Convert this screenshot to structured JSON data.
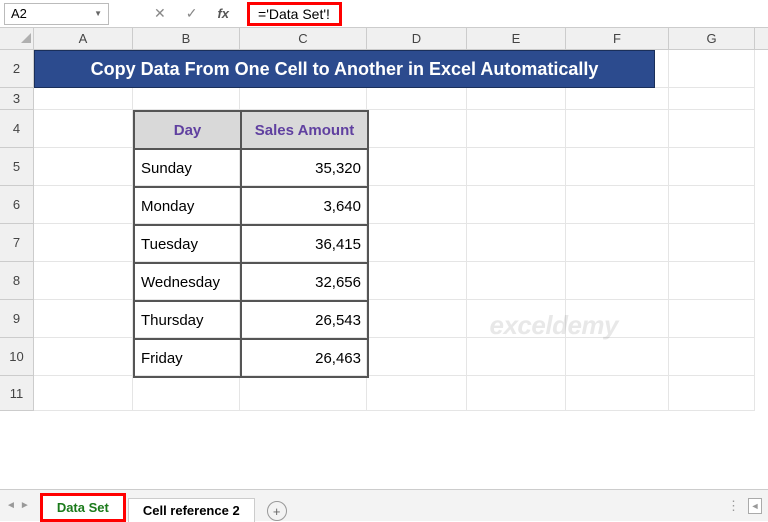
{
  "nameBox": "A2",
  "formula": "='Data Set'!",
  "columns": [
    "A",
    "B",
    "C",
    "D",
    "E",
    "F",
    "G"
  ],
  "rows": [
    "2",
    "3",
    "4",
    "5",
    "6",
    "7",
    "8",
    "9",
    "10",
    "11"
  ],
  "title": "Copy Data From One Cell to Another in Excel Automatically",
  "tableHeaders": {
    "day": "Day",
    "sales": "Sales Amount"
  },
  "tableData": [
    {
      "day": "Sunday",
      "sales": "35,320"
    },
    {
      "day": "Monday",
      "sales": "3,640"
    },
    {
      "day": "Tuesday",
      "sales": "36,415"
    },
    {
      "day": "Wednesday",
      "sales": "32,656"
    },
    {
      "day": "Thursday",
      "sales": "26,543"
    },
    {
      "day": "Friday",
      "sales": "26,463"
    }
  ],
  "sheets": {
    "active": "Data Set",
    "other": "Cell reference 2"
  },
  "watermark": "exceldemy"
}
